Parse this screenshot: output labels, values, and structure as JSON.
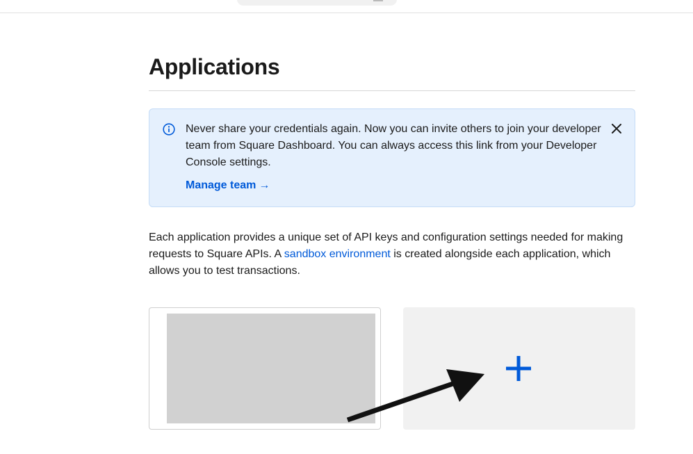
{
  "page": {
    "title": "Applications"
  },
  "banner": {
    "message": "Never share your credentials again. Now you can invite others to join your developer team from Square Dashboard. You can always access this link from your Developer Console settings.",
    "link_label": "Manage team",
    "link_arrow": "→",
    "info_icon": "info-icon",
    "close_icon": "close-icon"
  },
  "description": {
    "before_link": "Each application provides a unique set of API keys and configuration settings needed for making requests to Square APIs. A ",
    "link_label": "sandbox environment",
    "after_link": " is created alongside each application, which allows you to test transactions."
  },
  "cards": {
    "add_icon": "plus-icon"
  },
  "colors": {
    "accent": "#005ad9",
    "banner_bg": "#e5f0fd",
    "add_card_bg": "#f1f1f1",
    "thumb_bg": "#d1d1d1"
  }
}
